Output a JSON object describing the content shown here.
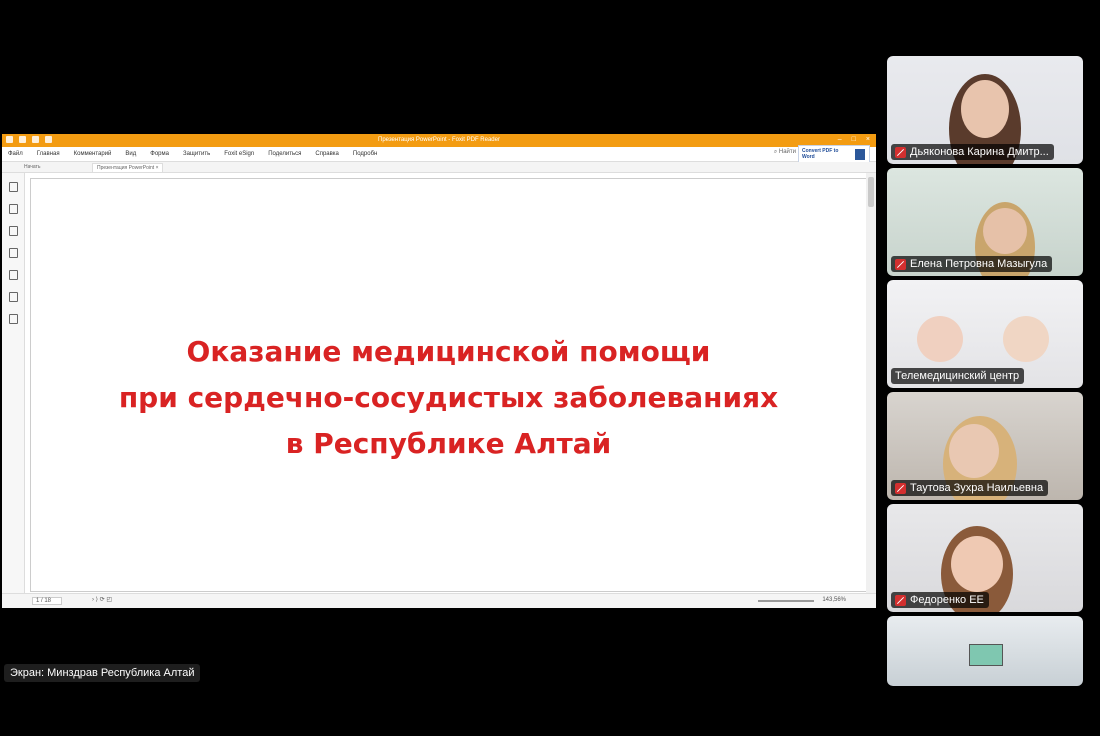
{
  "foxit": {
    "window_title": "Презентация PowerPoint - Foxit PDF Reader",
    "menu": [
      "Файл",
      "Главная",
      "Комментарий",
      "Вид",
      "Форма",
      "Защитить",
      "Foxit eSign",
      "Поделиться",
      "Справка",
      "Подробн"
    ],
    "search_placeholder": "Найти",
    "convert_badge": "Convert PDF to Word",
    "tabs": [
      "Начать",
      "Презентация PowerPoint"
    ],
    "page_indicator": "1 / 18",
    "zoom": "143,56%"
  },
  "slide": {
    "title_lines": [
      "Оказание медицинской помощи",
      "при сердечно-сосудистых заболеваниях",
      "в Республике Алтай"
    ]
  },
  "screen_share_label": "Экран: Минздрав Республика Алтай",
  "participants": [
    {
      "name": "Дьяконова Карина Дмитр...",
      "muted": true
    },
    {
      "name": "Елена Петровна Мазыгула",
      "muted": true
    },
    {
      "name": "Телемедицинский центр",
      "muted": false
    },
    {
      "name": "Таутова Зухра Наильевна",
      "muted": true
    },
    {
      "name": "Федоренко ЕЕ",
      "muted": true
    }
  ],
  "colors": {
    "accent_orange": "#f39c12",
    "slide_red": "#d92323",
    "muted_red": "#d32f2f"
  }
}
